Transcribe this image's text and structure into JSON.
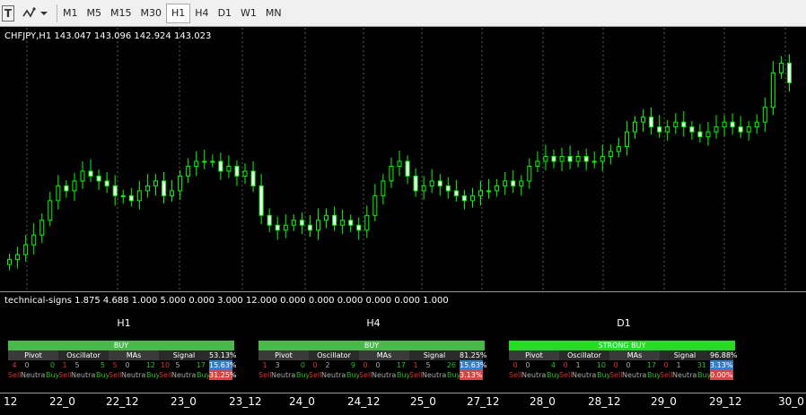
{
  "toolbar": {
    "icons": [
      "text-tool-icon",
      "objects-icon",
      "dropdown-arrow-icon"
    ],
    "timeframes": [
      "M1",
      "M5",
      "M15",
      "M30",
      "H1",
      "H4",
      "D1",
      "W1",
      "MN"
    ],
    "active_timeframe": "H1",
    "text_tool_glyph": "T"
  },
  "chart": {
    "symbol_label": "CHFJPY,H1  143.047 143.096 142.924 143.023",
    "indicator_label": "technical-signs 1.875 4.688 1.000 5.000 0.000 3.000 12.000 0.000 0.000 0.000 0.000 0.000 1.000",
    "colors": {
      "background": "#000000",
      "candle": "#00ff00",
      "grid": "#5a5a5a"
    }
  },
  "chart_data": {
    "type": "candlestick",
    "title": "",
    "x_tick_labels": [
      "12",
      "22_0",
      "22_12",
      "23_0",
      "23_12",
      "24_0",
      "24_12",
      "25_0",
      "27_12",
      "28_0",
      "28_12",
      "29_0",
      "29_12",
      "30_0"
    ],
    "closes": [
      143.0,
      143.1,
      143.3,
      143.5,
      143.8,
      144.2,
      144.5,
      144.4,
      144.6,
      144.8,
      144.7,
      144.6,
      144.5,
      144.3,
      144.3,
      144.2,
      144.4,
      144.5,
      144.6,
      144.3,
      144.4,
      144.7,
      144.9,
      145.0,
      145.0,
      145.0,
      144.8,
      144.9,
      144.7,
      144.8,
      144.5,
      143.9,
      143.7,
      143.6,
      143.7,
      143.8,
      143.7,
      143.6,
      143.8,
      143.9,
      143.7,
      143.8,
      143.7,
      143.6,
      143.9,
      144.3,
      144.6,
      144.9,
      145.0,
      144.7,
      144.4,
      144.5,
      144.6,
      144.5,
      144.4,
      144.3,
      144.2,
      144.3,
      144.4,
      144.4,
      144.5,
      144.6,
      144.5,
      144.6,
      144.9,
      145.0,
      145.1,
      145.0,
      145.1,
      145.0,
      145.1,
      145.0,
      145.0,
      145.1,
      145.2,
      145.3,
      145.6,
      145.8,
      145.9,
      145.7,
      145.6,
      145.7,
      145.8,
      145.7,
      145.6,
      145.5,
      145.6,
      145.7,
      145.8,
      145.7,
      145.6,
      145.7,
      145.8,
      146.1,
      146.8,
      147.0,
      146.6
    ]
  },
  "panels": [
    {
      "title": "H1",
      "signal": "BUY",
      "signal_color": "#4bb84b",
      "headers": [
        "Pivot",
        "Oscillator",
        "MAs",
        "Signal"
      ],
      "counts": [
        [
          "4",
          "0",
          "0"
        ],
        [
          "1",
          "5",
          "5"
        ],
        [
          "5",
          "0",
          "12"
        ],
        [
          "10",
          "5",
          "17"
        ]
      ],
      "labels": [
        "Sell",
        "Neutral",
        "Buy"
      ],
      "percentages": [
        "53.13%",
        "15.63%",
        "31.25%"
      ]
    },
    {
      "title": "H4",
      "signal": "BUY",
      "signal_color": "#4bb84b",
      "headers": [
        "Pivot",
        "Oscillator",
        "MAs",
        "Signal"
      ],
      "counts": [
        [
          "1",
          "3",
          "0"
        ],
        [
          "0",
          "2",
          "9"
        ],
        [
          "0",
          "0",
          "17"
        ],
        [
          "1",
          "5",
          "26"
        ]
      ],
      "labels": [
        "Sell",
        "Neutral",
        "Buy"
      ],
      "percentages": [
        "81.25%",
        "15.63%",
        "3.13%"
      ]
    },
    {
      "title": "D1",
      "signal": "STRONG BUY",
      "signal_color": "#22dd22",
      "headers": [
        "Pivot",
        "Oscillator",
        "MAs",
        "Signal"
      ],
      "counts": [
        [
          "0",
          "0",
          "4"
        ],
        [
          "0",
          "1",
          "10"
        ],
        [
          "0",
          "0",
          "17"
        ],
        [
          "0",
          "1",
          "31"
        ]
      ],
      "labels": [
        "Sell",
        "Neutral",
        "Buy"
      ],
      "percentages": [
        "96.88%",
        "3.13%",
        "0.00%"
      ]
    }
  ]
}
